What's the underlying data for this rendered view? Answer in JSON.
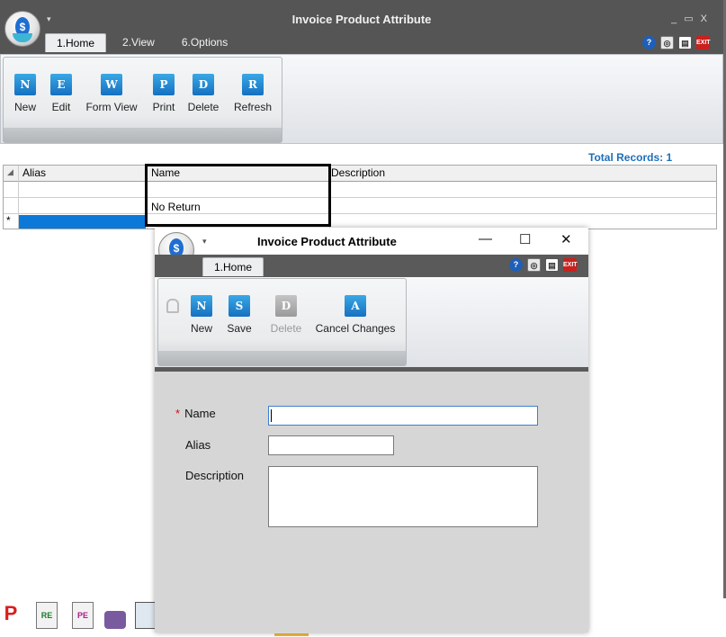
{
  "main_window": {
    "title": "Invoice Product Attribute",
    "window_controls": [
      "_",
      "▭",
      "X"
    ],
    "tabs": [
      {
        "label": "1.Home",
        "active": true
      },
      {
        "label": "2.View",
        "active": false
      },
      {
        "label": "6.Options",
        "active": false
      }
    ],
    "ribbon_buttons": [
      {
        "label": "New",
        "icon": "new-icon",
        "glyph": "N"
      },
      {
        "label": "Edit",
        "icon": "edit-icon",
        "glyph": "E"
      },
      {
        "label": "Form View",
        "icon": "form-view-icon",
        "glyph": "W"
      },
      {
        "label": "Print",
        "icon": "print-icon",
        "glyph": "P"
      },
      {
        "label": "Delete",
        "icon": "delete-icon",
        "glyph": "D"
      },
      {
        "label": "Refresh",
        "icon": "refresh-icon",
        "glyph": "R"
      }
    ],
    "total_records": "Total Records: 1",
    "grid": {
      "columns": [
        "Alias",
        "Name",
        "Description"
      ],
      "rows": [
        {
          "alias": "",
          "name": "",
          "description": ""
        },
        {
          "alias": "",
          "name": "No Return",
          "description": ""
        }
      ],
      "new_row_marker": "*"
    }
  },
  "dialog": {
    "title": "Invoice Product Attribute",
    "window_controls": [
      "—",
      "☐",
      "✕"
    ],
    "tabs": [
      {
        "label": "1.Home",
        "active": true
      }
    ],
    "ribbon_buttons": [
      {
        "label": "New",
        "icon": "new-icon",
        "glyph": "N",
        "enabled": true
      },
      {
        "label": "Save",
        "icon": "save-icon",
        "glyph": "S",
        "enabled": true
      },
      {
        "label": "Delete",
        "icon": "delete-icon",
        "glyph": "D",
        "enabled": false
      },
      {
        "label": "Cancel Changes",
        "icon": "cancel-changes-icon",
        "glyph": "A",
        "enabled": true
      }
    ],
    "form": {
      "name": {
        "label": "Name",
        "required_marker": "*",
        "value": ""
      },
      "alias": {
        "label": "Alias",
        "value": ""
      },
      "description": {
        "label": "Description",
        "value": ""
      }
    }
  },
  "system_icons": [
    "help-icon",
    "search-doc-icon",
    "notes-icon",
    "exit-icon"
  ],
  "exit_icon_text": "EXIT",
  "taskbar_icons": [
    {
      "name": "p-app-icon",
      "text": "P"
    },
    {
      "name": "re-report-icon",
      "text": "RE"
    },
    {
      "name": "pe-report-icon",
      "text": "PE"
    },
    {
      "name": "toolbox-icon",
      "text": ""
    },
    {
      "name": "display-icon",
      "text": ""
    }
  ],
  "colors": {
    "title_bar": "#555555",
    "accent_blue": "#1e6fb8",
    "selection": "#0c79d8",
    "required": "#d01010"
  }
}
